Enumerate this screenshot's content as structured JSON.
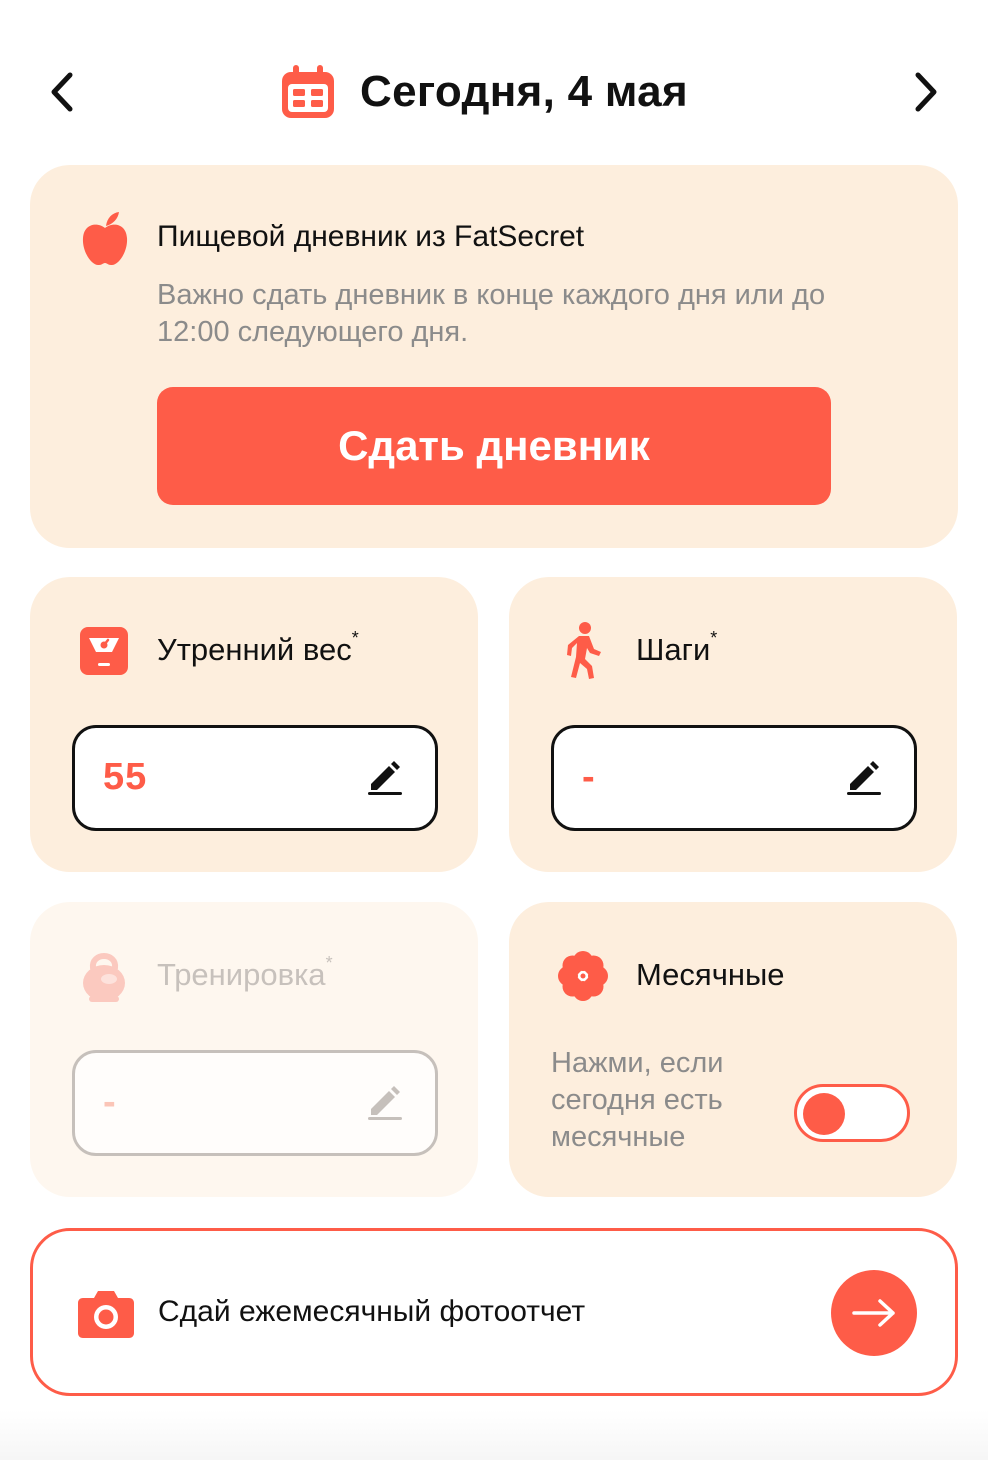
{
  "header": {
    "title": "Сегодня, 4 мая",
    "prev_icon": "chevron-left-icon",
    "next_icon": "chevron-right-icon",
    "calendar_icon": "calendar-icon"
  },
  "diary": {
    "icon": "apple-icon",
    "title": "Пищевой дневник из FatSecret",
    "description": "Важно сдать дневник в конце каждого дня или до 12:00 следующего дня.",
    "button_label": "Сдать дневник"
  },
  "weight": {
    "icon": "scale-icon",
    "title": "Утренний вес",
    "required_mark": "*",
    "value": "55"
  },
  "steps": {
    "icon": "walking-icon",
    "title": "Шаги",
    "required_mark": "*",
    "value": "-"
  },
  "training": {
    "icon": "kettlebell-icon",
    "title": "Тренировка",
    "required_mark": "*",
    "value": "-",
    "disabled": true
  },
  "period": {
    "icon": "flower-icon",
    "title": "Месячные",
    "description": "Нажми, если сегодня есть месячные",
    "toggle_on": false
  },
  "photo_report": {
    "icon": "camera-icon",
    "label": "Сдай ежемесячный фотоотчет",
    "arrow_icon": "arrow-right-icon"
  },
  "colors": {
    "accent": "#fe5c48",
    "card_bg": "#fdeedd",
    "muted_text": "#8b8b8b"
  }
}
